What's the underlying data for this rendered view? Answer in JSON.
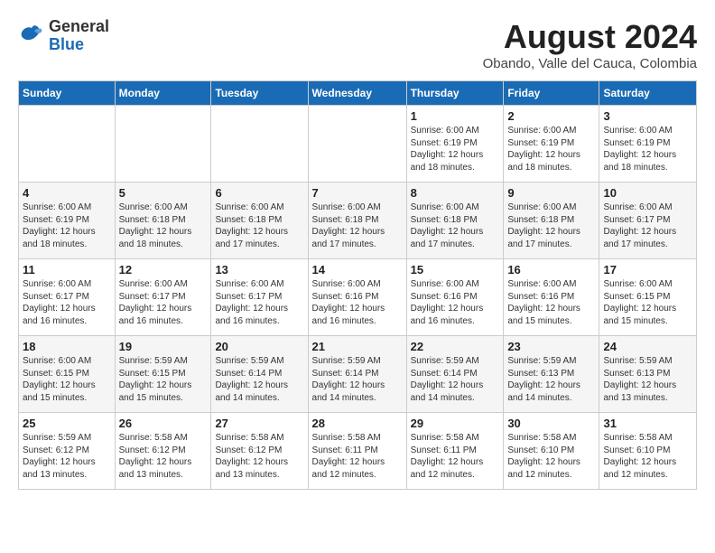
{
  "header": {
    "logo": {
      "line1": "General",
      "line2": "Blue"
    },
    "title": "August 2024",
    "location": "Obando, Valle del Cauca, Colombia"
  },
  "days_of_week": [
    "Sunday",
    "Monday",
    "Tuesday",
    "Wednesday",
    "Thursday",
    "Friday",
    "Saturday"
  ],
  "weeks": [
    [
      {
        "day": "",
        "detail": ""
      },
      {
        "day": "",
        "detail": ""
      },
      {
        "day": "",
        "detail": ""
      },
      {
        "day": "",
        "detail": ""
      },
      {
        "day": "1",
        "detail": "Sunrise: 6:00 AM\nSunset: 6:19 PM\nDaylight: 12 hours\nand 18 minutes."
      },
      {
        "day": "2",
        "detail": "Sunrise: 6:00 AM\nSunset: 6:19 PM\nDaylight: 12 hours\nand 18 minutes."
      },
      {
        "day": "3",
        "detail": "Sunrise: 6:00 AM\nSunset: 6:19 PM\nDaylight: 12 hours\nand 18 minutes."
      }
    ],
    [
      {
        "day": "4",
        "detail": "Sunrise: 6:00 AM\nSunset: 6:19 PM\nDaylight: 12 hours\nand 18 minutes."
      },
      {
        "day": "5",
        "detail": "Sunrise: 6:00 AM\nSunset: 6:18 PM\nDaylight: 12 hours\nand 18 minutes."
      },
      {
        "day": "6",
        "detail": "Sunrise: 6:00 AM\nSunset: 6:18 PM\nDaylight: 12 hours\nand 17 minutes."
      },
      {
        "day": "7",
        "detail": "Sunrise: 6:00 AM\nSunset: 6:18 PM\nDaylight: 12 hours\nand 17 minutes."
      },
      {
        "day": "8",
        "detail": "Sunrise: 6:00 AM\nSunset: 6:18 PM\nDaylight: 12 hours\nand 17 minutes."
      },
      {
        "day": "9",
        "detail": "Sunrise: 6:00 AM\nSunset: 6:18 PM\nDaylight: 12 hours\nand 17 minutes."
      },
      {
        "day": "10",
        "detail": "Sunrise: 6:00 AM\nSunset: 6:17 PM\nDaylight: 12 hours\nand 17 minutes."
      }
    ],
    [
      {
        "day": "11",
        "detail": "Sunrise: 6:00 AM\nSunset: 6:17 PM\nDaylight: 12 hours\nand 16 minutes."
      },
      {
        "day": "12",
        "detail": "Sunrise: 6:00 AM\nSunset: 6:17 PM\nDaylight: 12 hours\nand 16 minutes."
      },
      {
        "day": "13",
        "detail": "Sunrise: 6:00 AM\nSunset: 6:17 PM\nDaylight: 12 hours\nand 16 minutes."
      },
      {
        "day": "14",
        "detail": "Sunrise: 6:00 AM\nSunset: 6:16 PM\nDaylight: 12 hours\nand 16 minutes."
      },
      {
        "day": "15",
        "detail": "Sunrise: 6:00 AM\nSunset: 6:16 PM\nDaylight: 12 hours\nand 16 minutes."
      },
      {
        "day": "16",
        "detail": "Sunrise: 6:00 AM\nSunset: 6:16 PM\nDaylight: 12 hours\nand 15 minutes."
      },
      {
        "day": "17",
        "detail": "Sunrise: 6:00 AM\nSunset: 6:15 PM\nDaylight: 12 hours\nand 15 minutes."
      }
    ],
    [
      {
        "day": "18",
        "detail": "Sunrise: 6:00 AM\nSunset: 6:15 PM\nDaylight: 12 hours\nand 15 minutes."
      },
      {
        "day": "19",
        "detail": "Sunrise: 5:59 AM\nSunset: 6:15 PM\nDaylight: 12 hours\nand 15 minutes."
      },
      {
        "day": "20",
        "detail": "Sunrise: 5:59 AM\nSunset: 6:14 PM\nDaylight: 12 hours\nand 14 minutes."
      },
      {
        "day": "21",
        "detail": "Sunrise: 5:59 AM\nSunset: 6:14 PM\nDaylight: 12 hours\nand 14 minutes."
      },
      {
        "day": "22",
        "detail": "Sunrise: 5:59 AM\nSunset: 6:14 PM\nDaylight: 12 hours\nand 14 minutes."
      },
      {
        "day": "23",
        "detail": "Sunrise: 5:59 AM\nSunset: 6:13 PM\nDaylight: 12 hours\nand 14 minutes."
      },
      {
        "day": "24",
        "detail": "Sunrise: 5:59 AM\nSunset: 6:13 PM\nDaylight: 12 hours\nand 13 minutes."
      }
    ],
    [
      {
        "day": "25",
        "detail": "Sunrise: 5:59 AM\nSunset: 6:12 PM\nDaylight: 12 hours\nand 13 minutes."
      },
      {
        "day": "26",
        "detail": "Sunrise: 5:58 AM\nSunset: 6:12 PM\nDaylight: 12 hours\nand 13 minutes."
      },
      {
        "day": "27",
        "detail": "Sunrise: 5:58 AM\nSunset: 6:12 PM\nDaylight: 12 hours\nand 13 minutes."
      },
      {
        "day": "28",
        "detail": "Sunrise: 5:58 AM\nSunset: 6:11 PM\nDaylight: 12 hours\nand 12 minutes."
      },
      {
        "day": "29",
        "detail": "Sunrise: 5:58 AM\nSunset: 6:11 PM\nDaylight: 12 hours\nand 12 minutes."
      },
      {
        "day": "30",
        "detail": "Sunrise: 5:58 AM\nSunset: 6:10 PM\nDaylight: 12 hours\nand 12 minutes."
      },
      {
        "day": "31",
        "detail": "Sunrise: 5:58 AM\nSunset: 6:10 PM\nDaylight: 12 hours\nand 12 minutes."
      }
    ]
  ]
}
